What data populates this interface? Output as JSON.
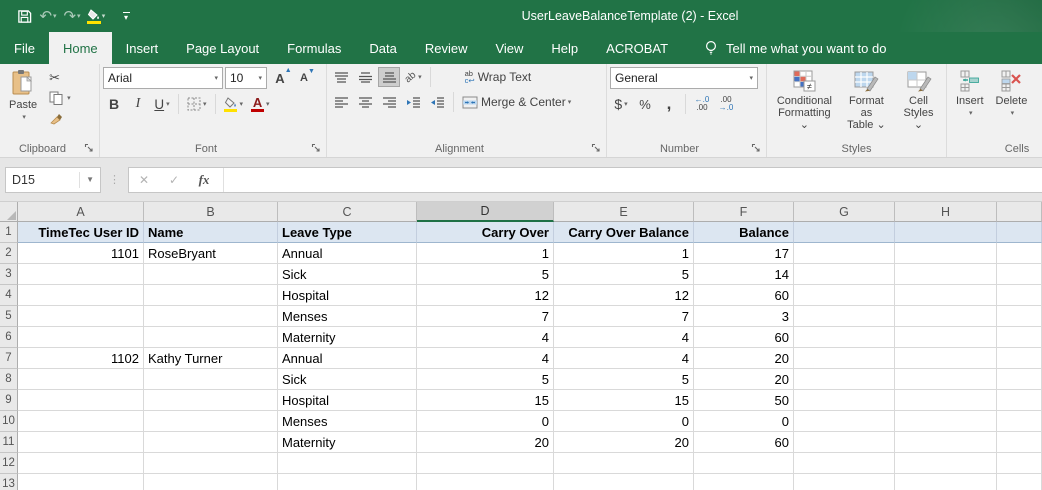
{
  "window": {
    "title": "UserLeaveBalanceTemplate (2)  -  Excel"
  },
  "qat": {
    "undo_glyph": "↶",
    "redo_glyph": "↷",
    "caret": "▾"
  },
  "tabs": [
    {
      "id": "file",
      "label": "File",
      "active": false
    },
    {
      "id": "home",
      "label": "Home",
      "active": true
    },
    {
      "id": "insert",
      "label": "Insert",
      "active": false
    },
    {
      "id": "page-layout",
      "label": "Page Layout",
      "active": false
    },
    {
      "id": "formulas",
      "label": "Formulas",
      "active": false
    },
    {
      "id": "data",
      "label": "Data",
      "active": false
    },
    {
      "id": "review",
      "label": "Review",
      "active": false
    },
    {
      "id": "view",
      "label": "View",
      "active": false
    },
    {
      "id": "help",
      "label": "Help",
      "active": false
    },
    {
      "id": "acrobat",
      "label": "ACROBAT",
      "active": false
    }
  ],
  "tellme": {
    "label": "Tell me what you want to do"
  },
  "ribbon": {
    "clipboard": {
      "label": "Clipboard",
      "paste": "Paste"
    },
    "font": {
      "label": "Font",
      "name": "Arial",
      "size": "10",
      "bold": "B",
      "italic": "I",
      "underline": "U"
    },
    "alignment": {
      "label": "Alignment",
      "wrap": "Wrap Text",
      "merge": "Merge & Center",
      "orient_glyph": "ab",
      "wrap_l1": "ab",
      "wrap_l2": "c↩"
    },
    "number": {
      "label": "Number",
      "format": "General",
      "currency": "$",
      "percent": "%",
      "comma": ",",
      "inc_top": "←.0",
      "inc_bottom": ".00",
      "dec_top": ".00",
      "dec_bottom": "→.0"
    },
    "styles": {
      "label": "Styles",
      "cond_l1": "Conditional",
      "cond_l2": "Formatting ⌄",
      "fmt_l1": "Format as",
      "fmt_l2": "Table ⌄",
      "cell_l1": "Cell",
      "cell_l2": "Styles ⌄"
    },
    "cells": {
      "label": "Cells",
      "insert": "Insert",
      "delete": "Delete"
    }
  },
  "formula": {
    "name_box": "D15",
    "cancel": "✕",
    "enter": "✓",
    "fx": "fx",
    "value": ""
  },
  "sheet": {
    "selected_column": "D",
    "columns": [
      {
        "id": "A",
        "width": 126
      },
      {
        "id": "B",
        "width": 134
      },
      {
        "id": "C",
        "width": 139
      },
      {
        "id": "D",
        "width": 137
      },
      {
        "id": "E",
        "width": 140
      },
      {
        "id": "F",
        "width": 100
      },
      {
        "id": "G",
        "width": 101
      },
      {
        "id": "H",
        "width": 102
      },
      {
        "id": "",
        "width": 45
      }
    ],
    "col_align": [
      "right",
      "left",
      "left",
      "right",
      "right",
      "right"
    ],
    "header_row": {
      "number": "1",
      "values": [
        "TimeTec User ID",
        "Name",
        "Leave Type",
        "Carry Over",
        "Carry Over Balance",
        "Balance"
      ]
    },
    "rows": [
      {
        "number": "2",
        "values": [
          "1101",
          "RoseBryant",
          "Annual",
          "1",
          "1",
          "17"
        ]
      },
      {
        "number": "3",
        "values": [
          "",
          "",
          "Sick",
          "5",
          "5",
          "14"
        ]
      },
      {
        "number": "4",
        "values": [
          "",
          "",
          "Hospital",
          "12",
          "12",
          "60"
        ]
      },
      {
        "number": "5",
        "values": [
          "",
          "",
          "Menses",
          "7",
          "7",
          "3"
        ]
      },
      {
        "number": "6",
        "values": [
          "",
          "",
          "Maternity",
          "4",
          "4",
          "60"
        ]
      },
      {
        "number": "7",
        "values": [
          "1102",
          "Kathy Turner",
          "Annual",
          "4",
          "4",
          "20"
        ]
      },
      {
        "number": "8",
        "values": [
          "",
          "",
          "Sick",
          "5",
          "5",
          "20"
        ]
      },
      {
        "number": "9",
        "values": [
          "",
          "",
          "Hospital",
          "15",
          "15",
          "50"
        ]
      },
      {
        "number": "10",
        "values": [
          "",
          "",
          "Menses",
          "0",
          "0",
          "0"
        ]
      },
      {
        "number": "11",
        "values": [
          "",
          "",
          "Maternity",
          "20",
          "20",
          "60"
        ]
      },
      {
        "number": "12",
        "values": [
          "",
          "",
          "",
          "",
          "",
          ""
        ]
      },
      {
        "number": "13",
        "values": [
          "",
          "",
          "",
          "",
          "",
          ""
        ]
      }
    ]
  },
  "colors": {
    "brand_green": "#217346",
    "header_row_fill": "#dce6f1",
    "fill_color_swatch": "#ffe100",
    "font_color_swatch": "#c00000"
  }
}
